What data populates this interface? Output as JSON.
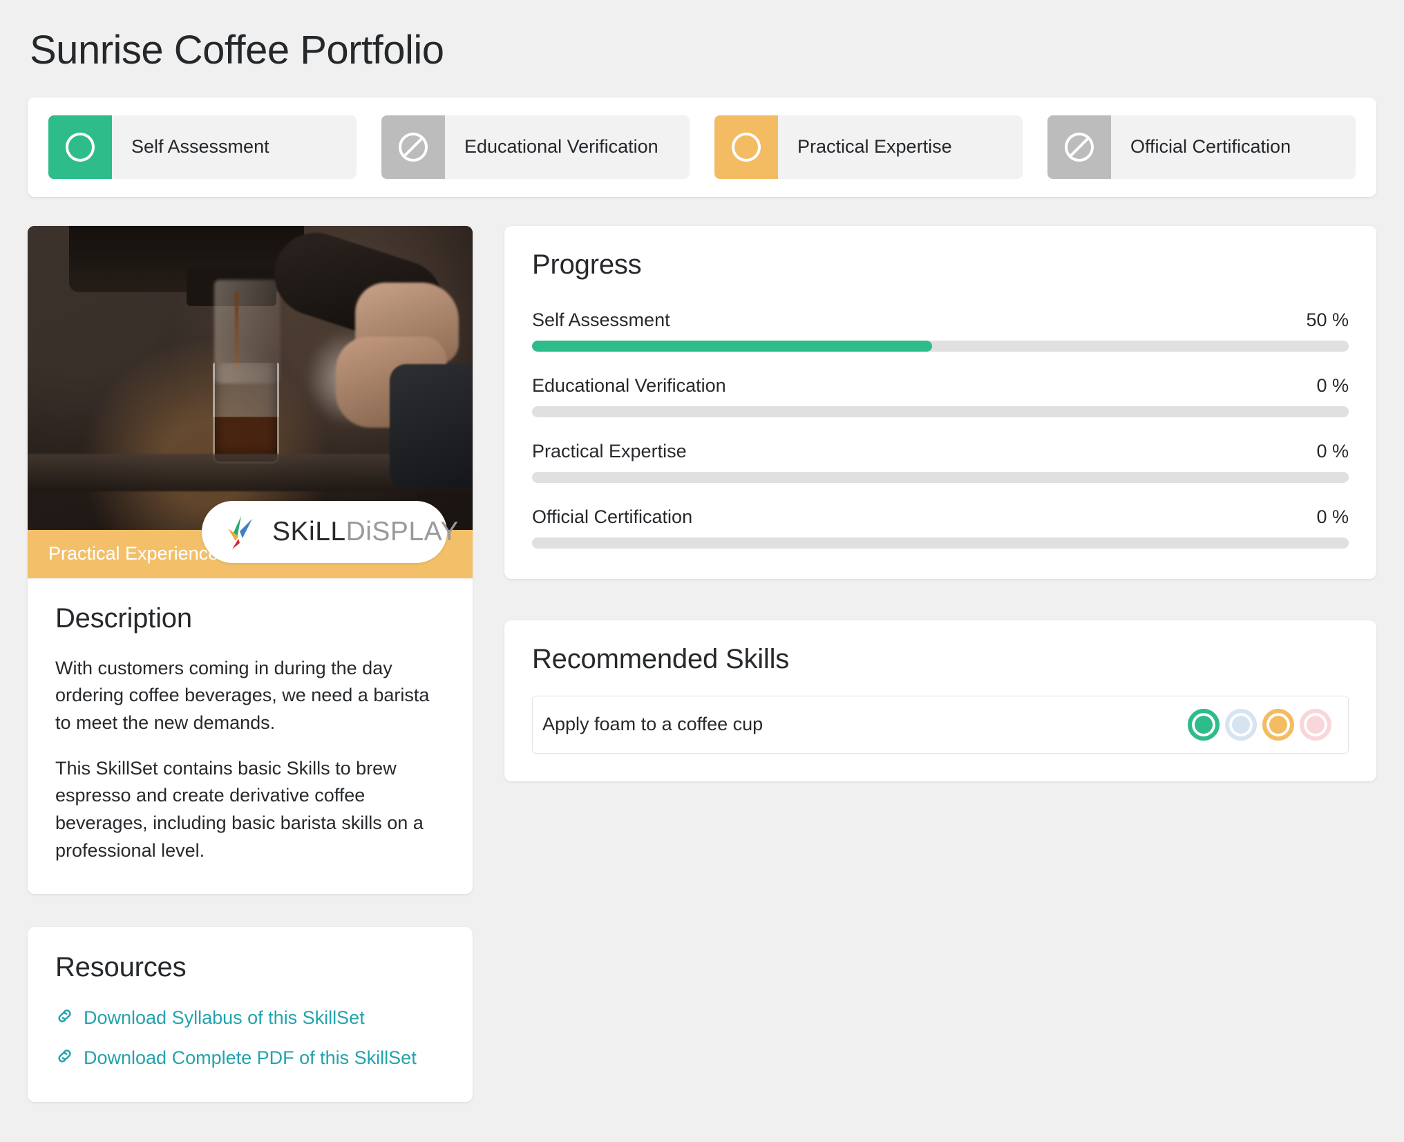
{
  "page": {
    "title": "Sunrise Coffee Portfolio"
  },
  "status_tabs": [
    {
      "label": "Self Assessment",
      "icon": "circle-outline-icon",
      "state": "active",
      "color": "#2ebc8b"
    },
    {
      "label": "Educational Verification",
      "icon": "blocked-icon",
      "state": "blocked",
      "color": "#bcbcbc"
    },
    {
      "label": "Practical Expertise",
      "icon": "circle-outline-icon",
      "state": "pending",
      "color": "#f3bc62"
    },
    {
      "label": "Official Certification",
      "icon": "blocked-icon",
      "state": "blocked",
      "color": "#bcbcbc"
    }
  ],
  "media": {
    "caption": "Practical Experience",
    "logo_primary": "SKiLL",
    "logo_secondary": "DiSPLAY",
    "logo_icon": "skilldisplay-logo-icon",
    "photo_alt": "Barista pulling an espresso shot"
  },
  "description": {
    "title": "Description",
    "paragraphs": [
      "With customers coming in during the day ordering coffee beverages, we need a barista to meet the new demands.",
      "This SkillSet contains basic Skills to brew espresso and create derivative coffee beverages, including basic barista skills on a professional level."
    ]
  },
  "resources": {
    "title": "Resources",
    "links": [
      {
        "label": "Download Syllabus of this SkillSet",
        "icon": "link-chain-icon"
      },
      {
        "label": "Download Complete PDF of this SkillSet",
        "icon": "link-chain-icon"
      }
    ],
    "link_color": "#23a3ad"
  },
  "progress": {
    "title": "Progress",
    "items": [
      {
        "label": "Self Assessment",
        "value_text": "50 %",
        "percent": 49,
        "color": "#2ebc8b"
      },
      {
        "label": "Educational Verification",
        "value_text": "0 %",
        "percent": 0,
        "color": "#2ebc8b"
      },
      {
        "label": "Practical Expertise",
        "value_text": "0 %",
        "percent": 0,
        "color": "#2ebc8b"
      },
      {
        "label": "Official Certification",
        "value_text": "0 %",
        "percent": 0,
        "color": "#2ebc8b"
      }
    ],
    "track_color": "#e0e0e0"
  },
  "recommended_skills": {
    "title": "Recommended Skills",
    "items": [
      {
        "name": "Apply foam to a coffee cup",
        "dots": [
          {
            "name": "self-assessment-dot",
            "color": "#2ebc8b"
          },
          {
            "name": "educational-verification-dot",
            "color": "#d6e4f2"
          },
          {
            "name": "practical-expertise-dot",
            "color": "#f3bc62"
          },
          {
            "name": "official-certification-dot",
            "color": "#f9d6da"
          }
        ]
      }
    ]
  }
}
